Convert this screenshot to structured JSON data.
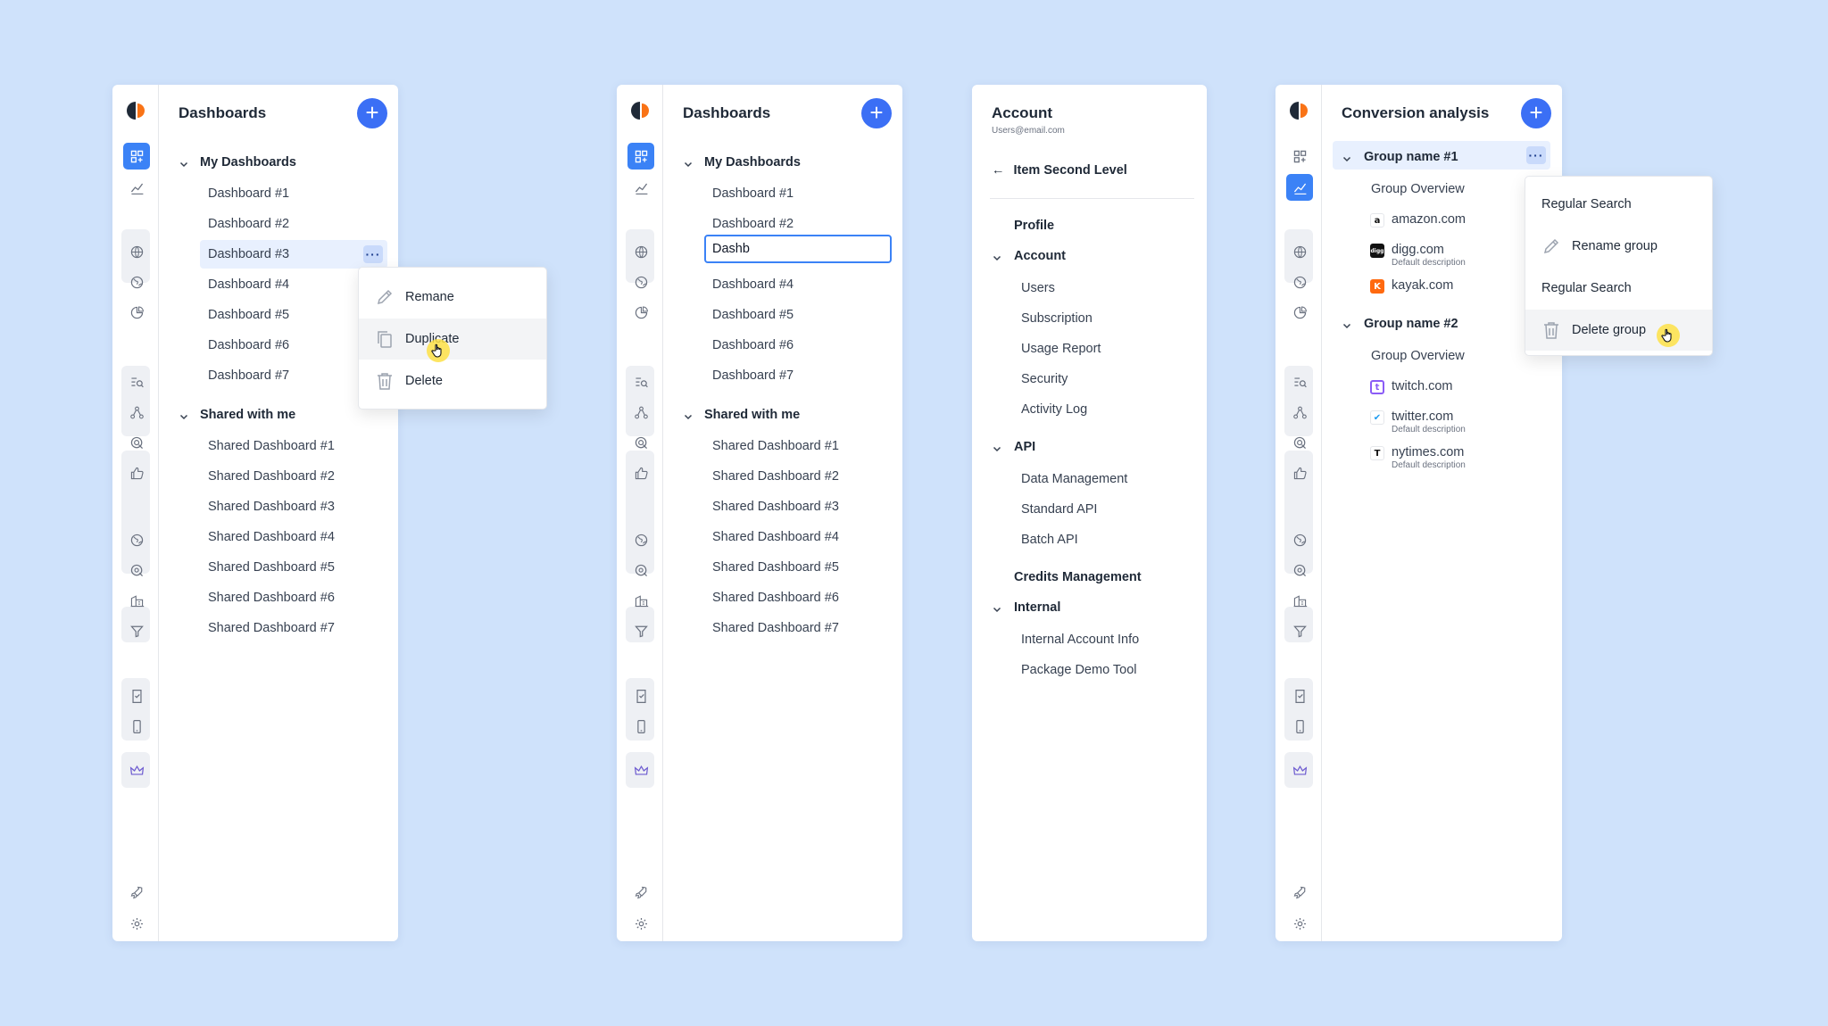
{
  "colors": {
    "accent": "#3b6ff5",
    "background": "#cfe2fb",
    "selected": "#e8f0fe"
  },
  "panel1": {
    "title": "Dashboards",
    "add_icon": "plus-icon",
    "sections": [
      {
        "label": "My Dashboards",
        "items": [
          "Dashboard #1",
          "Dashboard #2",
          "Dashboard #3",
          "Dashboard #4",
          "Dashboard #5",
          "Dashboard #6",
          "Dashboard #7"
        ]
      },
      {
        "label": "Shared with me",
        "items": [
          "Shared Dashboard #1",
          "Shared Dashboard #2",
          "Shared Dashboard #3",
          "Shared Dashboard #4",
          "Shared Dashboard #5",
          "Shared Dashboard #6",
          "Shared Dashboard #7"
        ]
      }
    ],
    "more_label": "···",
    "menu": [
      {
        "label": "Remane",
        "icon": "pencil-icon"
      },
      {
        "label": "Duplicate",
        "icon": "copy-icon"
      },
      {
        "label": "Delete",
        "icon": "trash-icon"
      }
    ]
  },
  "panel2": {
    "title": "Dashboards",
    "input_value": "Dashb",
    "sections": [
      {
        "label": "My Dashboards",
        "items": [
          "Dashboard #1",
          "Dashboard #2",
          "",
          "Dashboard #4",
          "Dashboard #5",
          "Dashboard #6",
          "Dashboard #7"
        ]
      },
      {
        "label": "Shared with me",
        "items": [
          "Shared Dashboard #1",
          "Shared Dashboard #2",
          "Shared Dashboard #3",
          "Shared Dashboard #4",
          "Shared Dashboard #5",
          "Shared Dashboard #6",
          "Shared Dashboard #7"
        ]
      }
    ]
  },
  "panel3": {
    "title": "Account",
    "subtitle": "Users@email.com",
    "back_label": "Item Second Level",
    "profile_label": "Profile",
    "account_label": "Account",
    "account_items": [
      "Users",
      "Subscription",
      "Usage Report",
      "Security",
      "Activity Log"
    ],
    "api_label": "API",
    "api_items": [
      "Data Management",
      "Standard API",
      "Batch API"
    ],
    "credits_label": "Credits Management",
    "internal_label": "Internal",
    "internal_items": [
      "Internal Account Info",
      "Package Demo Tool"
    ]
  },
  "panel4": {
    "title": "Conversion analysis",
    "more_label": "···",
    "groups": [
      {
        "label": "Group name #1",
        "overview": "Group Overview",
        "sites": [
          {
            "name": "amazon.com",
            "desc": "",
            "icon": "amazon-icon",
            "glyph": "a"
          },
          {
            "name": "digg.com",
            "desc": "Default description",
            "icon": "digg-icon",
            "glyph": "digg"
          },
          {
            "name": "kayak.com",
            "desc": "",
            "icon": "kayak-icon",
            "glyph": "K"
          }
        ]
      },
      {
        "label": "Group name #2",
        "overview": "Group Overview",
        "sites": [
          {
            "name": "twitch.com",
            "desc": "",
            "icon": "twitch-icon",
            "glyph": "t"
          },
          {
            "name": "twitter.com",
            "desc": "Default description",
            "icon": "twitter-icon",
            "glyph": "✔"
          },
          {
            "name": "nytimes.com",
            "desc": "Default description",
            "icon": "nytimes-icon",
            "glyph": "T"
          }
        ]
      }
    ],
    "menu": [
      {
        "label": "Regular Search",
        "icon": ""
      },
      {
        "label": "Rename group",
        "icon": "pencil-icon"
      },
      {
        "label": "Regular Search",
        "icon": ""
      },
      {
        "label": "Delete group",
        "icon": "trash-icon"
      }
    ]
  }
}
